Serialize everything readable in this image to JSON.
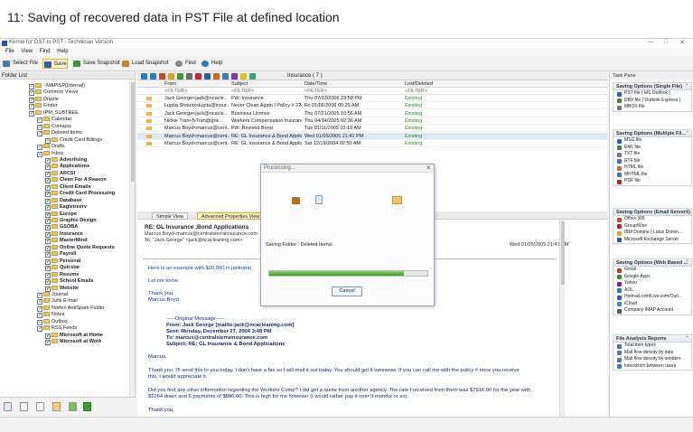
{
  "caption": "11:  Saving of recovered data in PST File at defined location",
  "window": {
    "title": "Kernel for OST to PST - Technician Version",
    "minimize": "—",
    "maximize": "□",
    "close": "✕"
  },
  "menu": [
    "File",
    "View",
    "Find",
    "Help"
  ],
  "toolbar": {
    "select_file": "Select File",
    "save": "Save",
    "save_snapshot": "Save Snapshot",
    "load_snapshot": "Load Snapshot",
    "find": "Find",
    "help": "Help"
  },
  "folder_list": {
    "title": "Folder List",
    "items": [
      {
        "label": "~MAPISP(Internal)",
        "indent": 0,
        "bold": false
      },
      {
        "label": "Common Views",
        "indent": 0,
        "bold": false
      },
      {
        "label": "Drizzle",
        "indent": 0,
        "bold": false
      },
      {
        "label": "Finder",
        "indent": 0,
        "bold": false
      },
      {
        "label": "IPM_SUBTREE",
        "indent": 0,
        "bold": false
      },
      {
        "label": "Calendar",
        "indent": 1,
        "bold": false
      },
      {
        "label": "Contacts",
        "indent": 1,
        "bold": false
      },
      {
        "label": "Deleted Items",
        "indent": 1,
        "bold": false
      },
      {
        "label": "Credit Card Billings",
        "indent": 2,
        "bold": false
      },
      {
        "label": "Drafts",
        "indent": 1,
        "bold": false
      },
      {
        "label": "Inbox",
        "indent": 1,
        "bold": false
      },
      {
        "label": "Advertising",
        "indent": 2,
        "bold": true
      },
      {
        "label": "Applications",
        "indent": 2,
        "bold": true
      },
      {
        "label": "ARCSI",
        "indent": 2,
        "bold": true
      },
      {
        "label": "Clean For A Reason",
        "indent": 2,
        "bold": true
      },
      {
        "label": "Client Emails",
        "indent": 2,
        "bold": true
      },
      {
        "label": "Credit Card Processing",
        "indent": 2,
        "bold": true
      },
      {
        "label": "Database",
        "indent": 2,
        "bold": true
      },
      {
        "label": "Eagletreerv",
        "indent": 2,
        "bold": true
      },
      {
        "label": "Europe",
        "indent": 2,
        "bold": true
      },
      {
        "label": "Graphic Design",
        "indent": 2,
        "bold": true
      },
      {
        "label": "GSOBA",
        "indent": 2,
        "bold": true
      },
      {
        "label": "Insurance",
        "indent": 2,
        "bold": true
      },
      {
        "label": "MasterMind",
        "indent": 2,
        "bold": true
      },
      {
        "label": "Online Quote Requests",
        "indent": 2,
        "bold": true
      },
      {
        "label": "Payroll",
        "indent": 2,
        "bold": true
      },
      {
        "label": "Personal",
        "indent": 2,
        "bold": true
      },
      {
        "label": "Quicstar",
        "indent": 2,
        "bold": true
      },
      {
        "label": "Resume",
        "indent": 2,
        "bold": true
      },
      {
        "label": "School Emails",
        "indent": 2,
        "bold": true
      },
      {
        "label": "Website",
        "indent": 2,
        "bold": true
      },
      {
        "label": "Journal",
        "indent": 1,
        "bold": false
      },
      {
        "label": "Junk E-mail",
        "indent": 1,
        "bold": false
      },
      {
        "label": "Norton AntiSpam Folder",
        "indent": 1,
        "bold": false
      },
      {
        "label": "Notes",
        "indent": 1,
        "bold": false
      },
      {
        "label": "Outbox",
        "indent": 1,
        "bold": false
      },
      {
        "label": "RSS Feeds",
        "indent": 1,
        "bold": false
      },
      {
        "label": "Microsoft at Home",
        "indent": 2,
        "bold": true
      },
      {
        "label": "Microsoft at Work",
        "indent": 2,
        "bold": true
      }
    ]
  },
  "mail_list": {
    "folder_title": "Insurance ( 7 )",
    "columns": {
      "from": "From",
      "subject": "Subject",
      "date": "Date/Time",
      "status": "Lost/Deleted"
    },
    "filter": "<FILTER>",
    "rows": [
      {
        "from": "Jack George<jack@ncacle...",
        "subject": "FW: Insurance",
        "date": "Thu 07/13/2006 23:50 PM",
        "status": "Existing"
      },
      {
        "from": "Lupita Shoultz<lupita@insur...",
        "subject": "Never Clean Again  |  Policy # 224F00...",
        "date": "Fri 01/06/2006 05:25 AM",
        "status": "Existing"
      },
      {
        "from": "Jack George<jack@ncacle...",
        "subject": "Business License",
        "date": "Thu 07/21/2005 10:56 AM",
        "status": "Existing"
      },
      {
        "from": "Nickie Tran<NTran@gnk...",
        "subject": "Workers Compensation Insurance Pro...",
        "date": "Thu 04/14/2005 02:36 AM",
        "status": "Existing"
      },
      {
        "from": "Marcus Boyd<marcus@cent...",
        "subject": "FW: Revised Bond",
        "date": "Tue 01/11/2005 03:19 AM",
        "status": "Existing"
      },
      {
        "from": "Marcus Boyd<marcus@cent...",
        "subject": "RE: GL Insurance & Bond Applications",
        "date": "Wed 01/05/2005 21:41 PM",
        "status": "Existing"
      },
      {
        "from": "Marcus Boyd<marcus@cent...",
        "subject": "RE: GL Insurance & Bond Applica...",
        "date": "Sat 12/18/2004 02:50 AM",
        "status": "Existing"
      }
    ]
  },
  "tabs": {
    "simple": "Simple View",
    "advanced": "Advanced Properties View"
  },
  "preview": {
    "subject": "RE: GL Insurance ,Bond Applications",
    "from_line": "Marcus Boyd<marcus@centralsierrainsurance.com",
    "to_line": "To:  \"Jack George\" <jack@ncacleaning.com>",
    "date": "Wed 01/05/2005 21:41 PM",
    "body_intro": "Here is an example with $20,000 in janitorial",
    "let_me_know": "Let me know.",
    "thanks": "Thank you,",
    "signature": "Marcus Boyd",
    "original_message": "-----Original Message-----",
    "orig_from": "From: Jack George [mailto:jack@ncacleaning.com]",
    "orig_sent": "Sent: Monday, December 27, 2004 3:48 PM",
    "orig_to": "To: marcus@centralsierrainsurance.com",
    "orig_subject": "Subject: RE: GL Insurance & Bond Applications",
    "greeting": "Marcus,",
    "para1_line1": "Thank you.  I'll send this to you today.  I don't have a fax so I will mail it out today.  You should get it tomorrow.  If you can call me with the policy # once you receive",
    "para1_line2": "this, I would appreciate it.",
    "para2_line1": "Did you find any other information regarding the Workers Comp? I did get a quote from another agency.  The rate I received from them was $7916.00 for the year with",
    "para2_line2": "$2264 down and 6 payments of $886.00.  This is high for me however (I would rather pay it over 9 months or so).",
    "thank_you": "Thank you,"
  },
  "dialog": {
    "title": "Processing...",
    "close": "✕",
    "saving_text": "Saving Folder : Deleted Items\\",
    "progress": 0.85,
    "cancel": "Cancel"
  },
  "task_pane": {
    "title": "Task Pane",
    "sections": [
      {
        "title": "Saving Options (Single File)",
        "items": [
          {
            "label": "PST file ( MS Outlook )",
            "color": "#2a5fb0"
          },
          {
            "label": "DBX file ( Outlook Express )",
            "color": "#3a8a3a"
          },
          {
            "label": "MBOX file",
            "color": "#777777"
          }
        ]
      },
      {
        "title": "Saving Options (Multiple Fil...",
        "items": [
          {
            "label": "MSG file",
            "color": "#2a5fb0"
          },
          {
            "label": "EML file",
            "color": "#3a8a3a"
          },
          {
            "label": "TXT file",
            "color": "#777777"
          },
          {
            "label": "RTF file",
            "color": "#4a6fb0"
          },
          {
            "label": "HTML file",
            "color": "#d06a1a"
          },
          {
            "label": "MHTML file",
            "color": "#3a78c0"
          },
          {
            "label": "PDF file",
            "color": "#c0281e"
          }
        ]
      },
      {
        "title": "Saving Options (Email Servers)",
        "items": [
          {
            "label": "Office 365",
            "color": "#d04a1a"
          },
          {
            "label": "GroupWise",
            "color": "#c02020"
          },
          {
            "label": "IBM Domino ( Lotus Domin...",
            "color": "#e0a020"
          },
          {
            "label": "Microsoft Exchange Server",
            "color": "#2a5fb0"
          }
        ]
      },
      {
        "title": "Saving Options (Web Based ...",
        "items": [
          {
            "label": "Gmail",
            "color": "#d03020"
          },
          {
            "label": "Google Apps",
            "color": "#3a8a3a"
          },
          {
            "label": "Yahoo",
            "color": "#6a2a9a"
          },
          {
            "label": "AOL",
            "color": "#2a7ac0"
          },
          {
            "label": "Hotmail.com/Live.com/Outl...",
            "color": "#2a5fb0"
          },
          {
            "label": "iCloud",
            "color": "#3a8ad0"
          },
          {
            "label": "Company IMAP Account",
            "color": "#555555"
          }
        ]
      },
      {
        "title": "File Analysis Reports",
        "items": [
          {
            "label": "Total item types",
            "color": "#4a78c0"
          },
          {
            "label": "Mail flow density by date",
            "color": "#4a78c0"
          },
          {
            "label": "Mail flow density by senders",
            "color": "#4a78c0"
          },
          {
            "label": "Interaction between users",
            "color": "#4a78c0"
          }
        ]
      }
    ]
  }
}
